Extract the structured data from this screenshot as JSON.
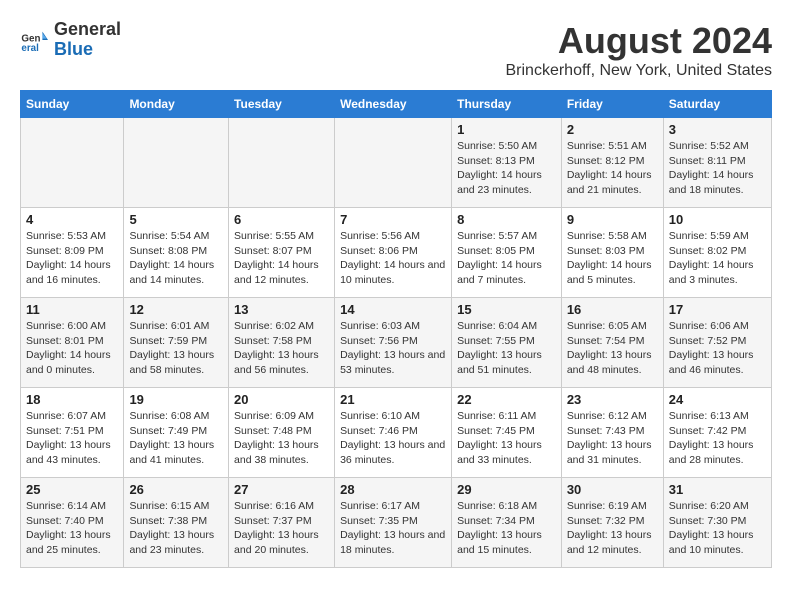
{
  "header": {
    "logo_general": "General",
    "logo_blue": "Blue",
    "title": "August 2024",
    "subtitle": "Brinckerhoff, New York, United States"
  },
  "days": [
    "Sunday",
    "Monday",
    "Tuesday",
    "Wednesday",
    "Thursday",
    "Friday",
    "Saturday"
  ],
  "weeks": [
    [
      {
        "date": "",
        "sunrise": "",
        "sunset": "",
        "daylight": ""
      },
      {
        "date": "",
        "sunrise": "",
        "sunset": "",
        "daylight": ""
      },
      {
        "date": "",
        "sunrise": "",
        "sunset": "",
        "daylight": ""
      },
      {
        "date": "",
        "sunrise": "",
        "sunset": "",
        "daylight": ""
      },
      {
        "date": "1",
        "sunrise": "5:50 AM",
        "sunset": "8:13 PM",
        "daylight": "14 hours and 23 minutes."
      },
      {
        "date": "2",
        "sunrise": "5:51 AM",
        "sunset": "8:12 PM",
        "daylight": "14 hours and 21 minutes."
      },
      {
        "date": "3",
        "sunrise": "5:52 AM",
        "sunset": "8:11 PM",
        "daylight": "14 hours and 18 minutes."
      }
    ],
    [
      {
        "date": "4",
        "sunrise": "5:53 AM",
        "sunset": "8:09 PM",
        "daylight": "14 hours and 16 minutes."
      },
      {
        "date": "5",
        "sunrise": "5:54 AM",
        "sunset": "8:08 PM",
        "daylight": "14 hours and 14 minutes."
      },
      {
        "date": "6",
        "sunrise": "5:55 AM",
        "sunset": "8:07 PM",
        "daylight": "14 hours and 12 minutes."
      },
      {
        "date": "7",
        "sunrise": "5:56 AM",
        "sunset": "8:06 PM",
        "daylight": "14 hours and 10 minutes."
      },
      {
        "date": "8",
        "sunrise": "5:57 AM",
        "sunset": "8:05 PM",
        "daylight": "14 hours and 7 minutes."
      },
      {
        "date": "9",
        "sunrise": "5:58 AM",
        "sunset": "8:03 PM",
        "daylight": "14 hours and 5 minutes."
      },
      {
        "date": "10",
        "sunrise": "5:59 AM",
        "sunset": "8:02 PM",
        "daylight": "14 hours and 3 minutes."
      }
    ],
    [
      {
        "date": "11",
        "sunrise": "6:00 AM",
        "sunset": "8:01 PM",
        "daylight": "14 hours and 0 minutes."
      },
      {
        "date": "12",
        "sunrise": "6:01 AM",
        "sunset": "7:59 PM",
        "daylight": "13 hours and 58 minutes."
      },
      {
        "date": "13",
        "sunrise": "6:02 AM",
        "sunset": "7:58 PM",
        "daylight": "13 hours and 56 minutes."
      },
      {
        "date": "14",
        "sunrise": "6:03 AM",
        "sunset": "7:56 PM",
        "daylight": "13 hours and 53 minutes."
      },
      {
        "date": "15",
        "sunrise": "6:04 AM",
        "sunset": "7:55 PM",
        "daylight": "13 hours and 51 minutes."
      },
      {
        "date": "16",
        "sunrise": "6:05 AM",
        "sunset": "7:54 PM",
        "daylight": "13 hours and 48 minutes."
      },
      {
        "date": "17",
        "sunrise": "6:06 AM",
        "sunset": "7:52 PM",
        "daylight": "13 hours and 46 minutes."
      }
    ],
    [
      {
        "date": "18",
        "sunrise": "6:07 AM",
        "sunset": "7:51 PM",
        "daylight": "13 hours and 43 minutes."
      },
      {
        "date": "19",
        "sunrise": "6:08 AM",
        "sunset": "7:49 PM",
        "daylight": "13 hours and 41 minutes."
      },
      {
        "date": "20",
        "sunrise": "6:09 AM",
        "sunset": "7:48 PM",
        "daylight": "13 hours and 38 minutes."
      },
      {
        "date": "21",
        "sunrise": "6:10 AM",
        "sunset": "7:46 PM",
        "daylight": "13 hours and 36 minutes."
      },
      {
        "date": "22",
        "sunrise": "6:11 AM",
        "sunset": "7:45 PM",
        "daylight": "13 hours and 33 minutes."
      },
      {
        "date": "23",
        "sunrise": "6:12 AM",
        "sunset": "7:43 PM",
        "daylight": "13 hours and 31 minutes."
      },
      {
        "date": "24",
        "sunrise": "6:13 AM",
        "sunset": "7:42 PM",
        "daylight": "13 hours and 28 minutes."
      }
    ],
    [
      {
        "date": "25",
        "sunrise": "6:14 AM",
        "sunset": "7:40 PM",
        "daylight": "13 hours and 25 minutes."
      },
      {
        "date": "26",
        "sunrise": "6:15 AM",
        "sunset": "7:38 PM",
        "daylight": "13 hours and 23 minutes."
      },
      {
        "date": "27",
        "sunrise": "6:16 AM",
        "sunset": "7:37 PM",
        "daylight": "13 hours and 20 minutes."
      },
      {
        "date": "28",
        "sunrise": "6:17 AM",
        "sunset": "7:35 PM",
        "daylight": "13 hours and 18 minutes."
      },
      {
        "date": "29",
        "sunrise": "6:18 AM",
        "sunset": "7:34 PM",
        "daylight": "13 hours and 15 minutes."
      },
      {
        "date": "30",
        "sunrise": "6:19 AM",
        "sunset": "7:32 PM",
        "daylight": "13 hours and 12 minutes."
      },
      {
        "date": "31",
        "sunrise": "6:20 AM",
        "sunset": "7:30 PM",
        "daylight": "13 hours and 10 minutes."
      }
    ]
  ],
  "labels": {
    "sunrise": "Sunrise:",
    "sunset": "Sunset:",
    "daylight": "Daylight:"
  }
}
